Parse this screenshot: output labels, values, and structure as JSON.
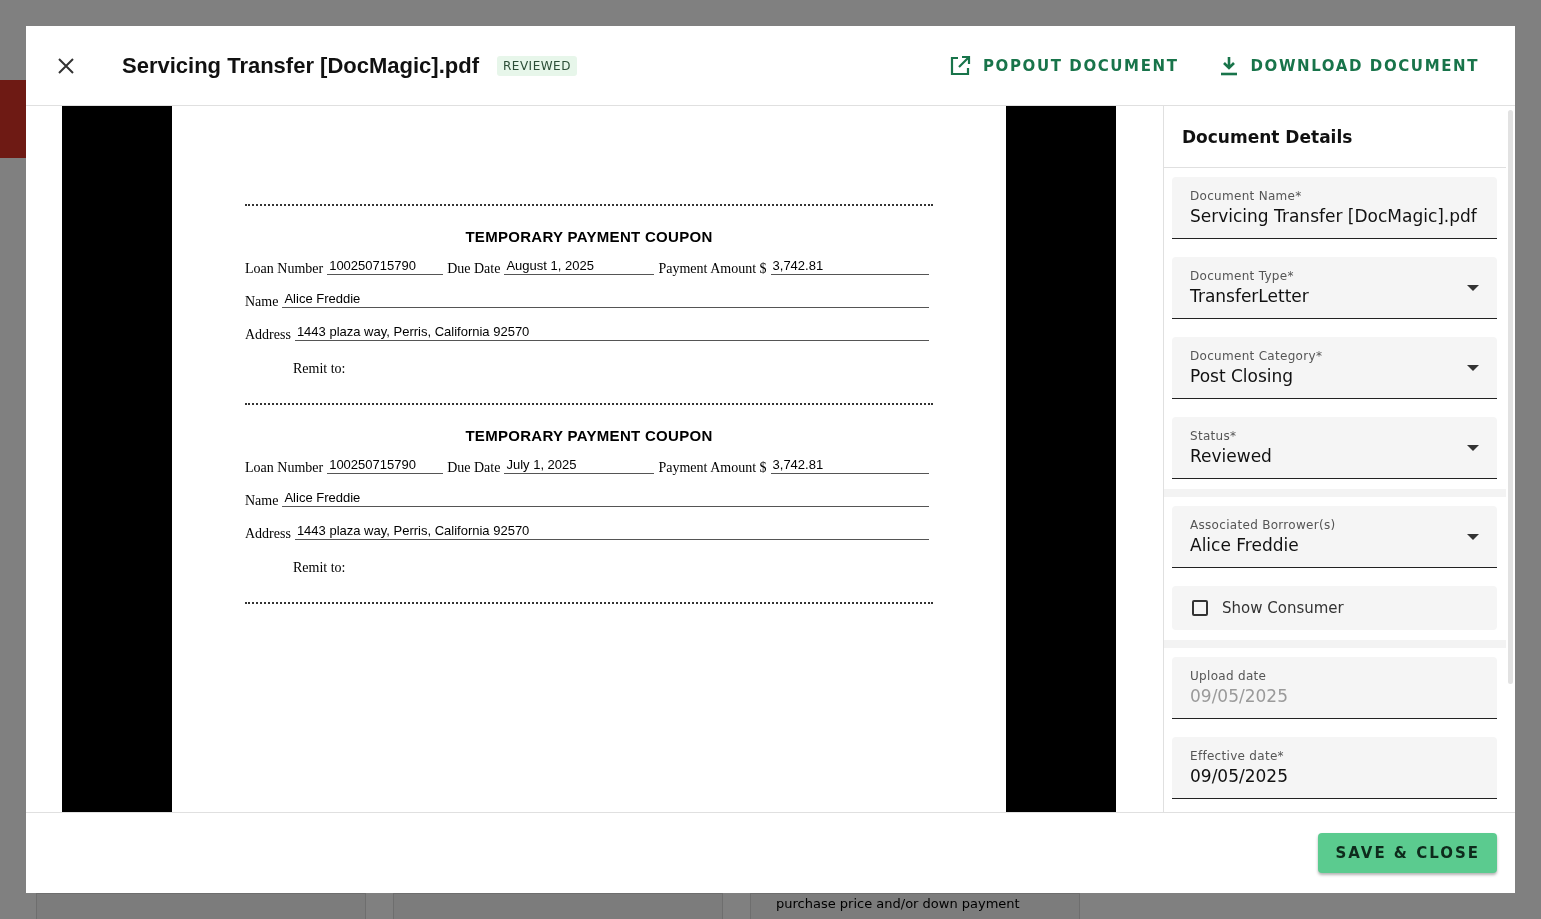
{
  "dialog": {
    "title": "Servicing Transfer [DocMagic].pdf",
    "badge": "REVIEWED",
    "actions": [
      {
        "kind": "popout",
        "label": "POPOUT DOCUMENT"
      },
      {
        "kind": "download",
        "label": "DOWNLOAD DOCUMENT"
      }
    ]
  },
  "document": {
    "coupons": [
      {
        "title": "TEMPORARY PAYMENT COUPON",
        "loan_number_label": "Loan Number",
        "loan_number": "100250715790",
        "due_date_label": "Due Date",
        "due_date": "August 1, 2025",
        "payment_amount_label": "Payment Amount $",
        "payment_amount": "3,742.81",
        "name_label": "Name",
        "name": "Alice Freddie",
        "address_label": "Address",
        "address": "1443 plaza way, Perris, California 92570",
        "remit_label": "Remit to:"
      },
      {
        "title": "TEMPORARY PAYMENT COUPON",
        "loan_number_label": "Loan Number",
        "loan_number": "100250715790",
        "due_date_label": "Due Date",
        "due_date": "July 1, 2025",
        "payment_amount_label": "Payment Amount $",
        "payment_amount": "3,742.81",
        "name_label": "Name",
        "name": "Alice Freddie",
        "address_label": "Address",
        "address": "1443 plaza way, Perris, California 92570",
        "remit_label": "Remit to:"
      }
    ]
  },
  "details": {
    "title": "Document Details",
    "groups": [
      [
        {
          "kind": "text",
          "label": "Document Name*",
          "value": "Servicing Transfer [DocMagic].pdf",
          "disabled": false
        },
        {
          "kind": "select",
          "label": "Document Type*",
          "value": "TransferLetter",
          "disabled": false
        },
        {
          "kind": "select",
          "label": "Document Category*",
          "value": "Post Closing",
          "disabled": false
        },
        {
          "kind": "select",
          "label": "Status*",
          "value": "Reviewed",
          "disabled": false
        }
      ],
      [
        {
          "kind": "select",
          "label": "Associated Borrower(s)",
          "value": "Alice Freddie",
          "disabled": false
        },
        {
          "kind": "checkbox",
          "label": "Show Consumer",
          "checked": false
        }
      ],
      [
        {
          "kind": "text",
          "label": "Upload date",
          "value": "09/05/2025",
          "disabled": true
        },
        {
          "kind": "text",
          "label": "Effective date*",
          "value": "09/05/2025",
          "disabled": false
        }
      ]
    ]
  },
  "footer": {
    "save_button": "SAVE & CLOSE"
  },
  "background": {
    "text": "purchase price and/or down payment"
  }
}
